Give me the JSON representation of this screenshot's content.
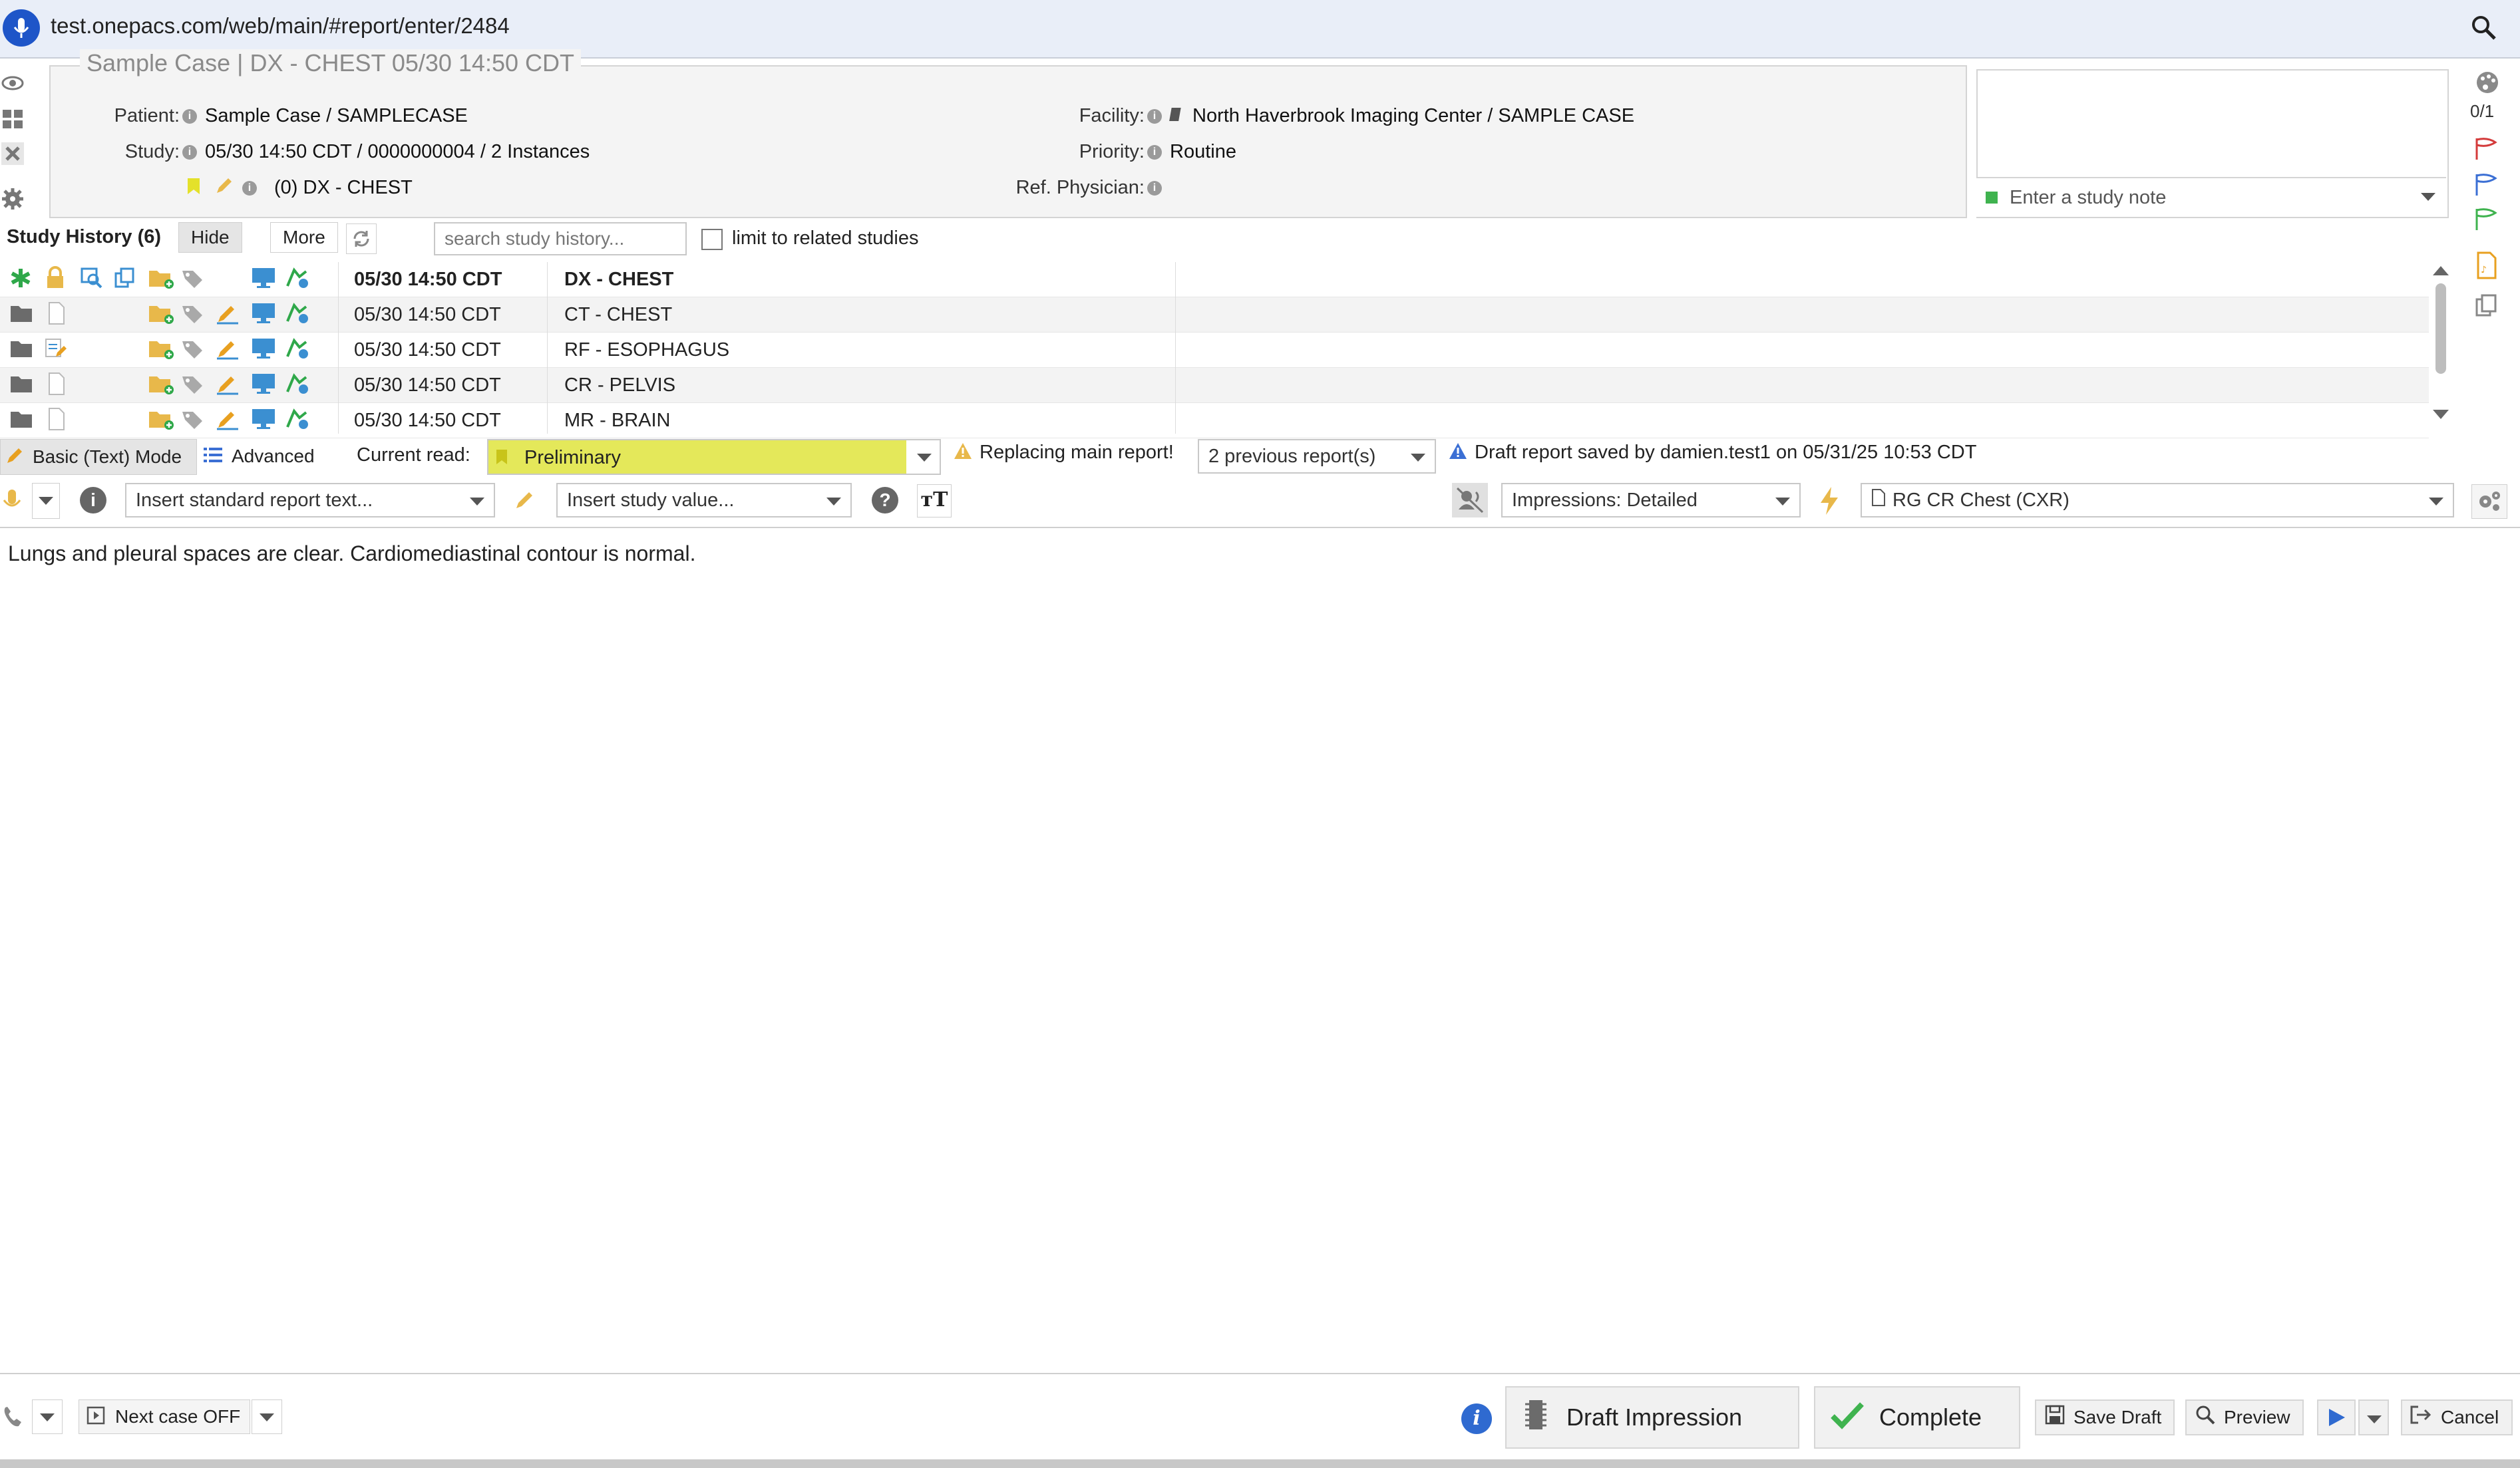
{
  "browser": {
    "url": "test.onepacs.com/web/main/#report/enter/2484"
  },
  "header": {
    "title": "Sample Case | DX - CHEST 05/30 14:50 CDT",
    "patient_label": "Patient:",
    "patient_value": "Sample Case / SAMPLECASE",
    "study_label": "Study:",
    "study_value": "05/30 14:50 CDT / 0000000004 / 2 Instances",
    "series_value": "(0) DX - CHEST",
    "facility_label": "Facility:",
    "facility_value": "North Haverbrook Imaging Center / SAMPLE CASE",
    "priority_label": "Priority:",
    "priority_value": "Routine",
    "refphys_label": "Ref. Physician:"
  },
  "note": {
    "placeholder": "Enter a study note",
    "counter": "0/1"
  },
  "study_history": {
    "title": "Study History (6)",
    "hide_label": "Hide",
    "more_label": "More",
    "search_placeholder": "search study history...",
    "limit_label": "limit to related studies",
    "rows": [
      {
        "date": "05/30 14:50 CDT",
        "desc": "DX - CHEST",
        "bold": true
      },
      {
        "date": "05/30 14:50 CDT",
        "desc": "CT - CHEST",
        "bold": false
      },
      {
        "date": "05/30 14:50 CDT",
        "desc": "RF - ESOPHAGUS",
        "bold": false
      },
      {
        "date": "05/30 14:50 CDT",
        "desc": "CR - PELVIS",
        "bold": false
      },
      {
        "date": "05/30 14:50 CDT",
        "desc": "MR - BRAIN",
        "bold": false
      }
    ]
  },
  "mode": {
    "basic_label": "Basic (Text) Mode",
    "advanced_label": "Advanced",
    "current_read_label": "Current read:",
    "current_read_value": "Preliminary",
    "replacing_label": "Replacing main report!",
    "previous_reports": "2 previous report(s)",
    "draft_saved": "Draft report saved by damien.test1 on 05/31/25 10:53 CDT"
  },
  "tools": {
    "std_text_placeholder": "Insert standard report text...",
    "study_value_placeholder": "Insert study value...",
    "impressions_value": "Impressions: Detailed",
    "template_value": "RG CR Chest (CXR)"
  },
  "editor": {
    "text": "Lungs and pleural spaces are clear. Cardiomediastinal contour is normal."
  },
  "footer": {
    "next_case": "Next case OFF",
    "draft_impression": "Draft Impression",
    "complete": "Complete",
    "save_draft": "Save Draft",
    "preview": "Preview",
    "cancel": "Cancel"
  },
  "colors": {
    "accent": "#1e55c8",
    "read_highlight": "#e4e85a",
    "folder": "#e8b84a",
    "monitor": "#3b8fd1"
  }
}
